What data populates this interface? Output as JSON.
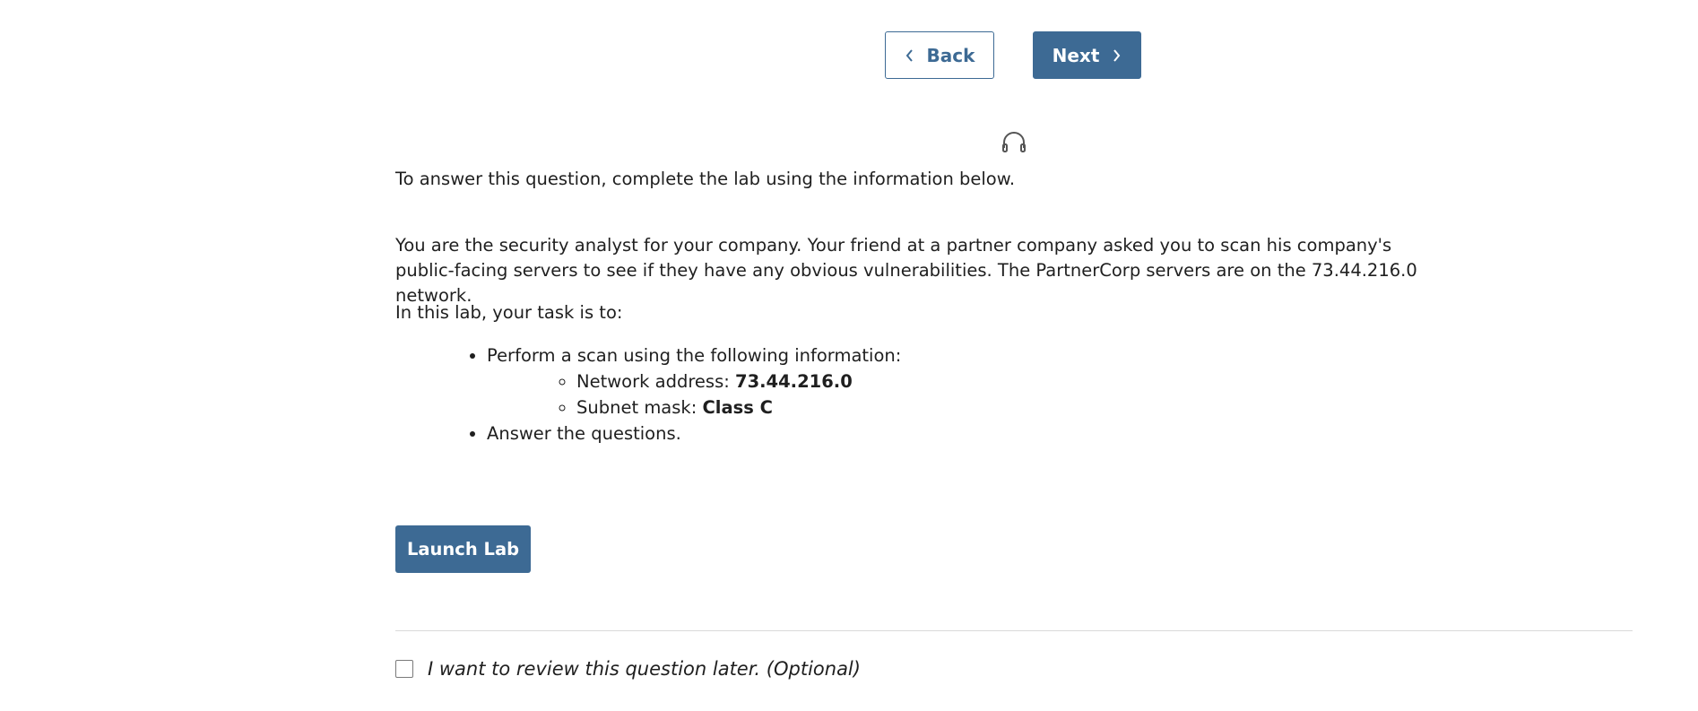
{
  "nav": {
    "back_label": "Back",
    "next_label": "Next"
  },
  "instructions": {
    "intro": "To answer this question, complete the lab using the information below.",
    "scenario": "You are the security analyst for your company. Your friend at a partner company asked you to scan his company's public-facing servers to see if they have any obvious vulnerabilities. The PartnerCorp servers are on the 73.44.216.0 network.",
    "task_heading": "In this lab, your task is to:",
    "tasks": [
      {
        "label": "Perform a scan using the following information:",
        "subitems": [
          {
            "label": "Network address: ",
            "value": "73.44.216.0"
          },
          {
            "label": "Subnet mask: ",
            "value": "Class C"
          }
        ]
      },
      {
        "label": "Answer the questions."
      }
    ]
  },
  "launch_label": "Launch Lab",
  "review_label": "I want to review this question later. (Optional)",
  "colors": {
    "accent": "#3d6a94",
    "text": "#1f1f1f",
    "divider": "#d9d9d9"
  },
  "icons": [
    "chevron-left-icon",
    "chevron-right-icon",
    "headphones-icon"
  ]
}
